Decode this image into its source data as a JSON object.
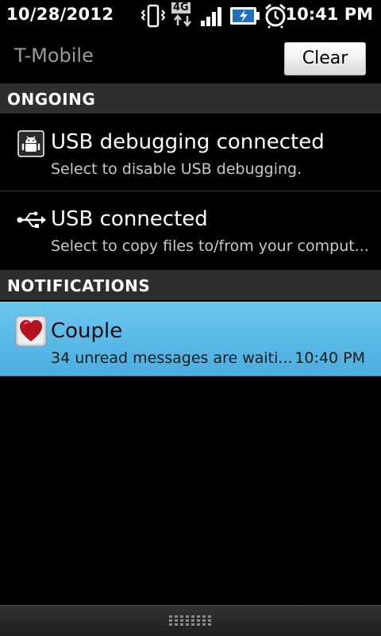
{
  "statusbar": {
    "date": "10/28/2012",
    "time": "10:41 PM",
    "icons": [
      "vibrate-icon",
      "4g-data-icon",
      "signal-icon",
      "battery-charging-icon",
      "alarm-icon"
    ],
    "network_label": "4G"
  },
  "header": {
    "carrier": "T-Mobile",
    "clear_label": "Clear"
  },
  "sections": {
    "ongoing": "ONGOING",
    "notifications": "NOTIFICATIONS"
  },
  "ongoing": [
    {
      "icon": "android-debug-icon",
      "title": "USB debugging connected",
      "subtitle": "Select to disable USB debugging."
    },
    {
      "icon": "usb-icon",
      "title": "USB connected",
      "subtitle": "Select to copy files to/from your comput..."
    }
  ],
  "notifications": [
    {
      "icon": "heart-icon",
      "title": "Couple",
      "subtitle": "34 unread messages are waiti...",
      "time": "10:40 PM",
      "highlight": "#5ab9e8"
    }
  ]
}
